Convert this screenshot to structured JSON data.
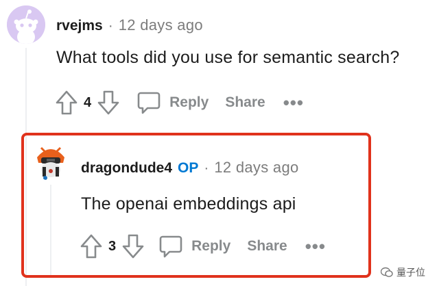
{
  "comment1": {
    "username": "rvejms",
    "separator": "·",
    "time": "12 days ago",
    "body": "What tools did you use for semantic search?",
    "votes": "4",
    "reply_label": "Reply",
    "share_label": "Share",
    "more_label": "•••"
  },
  "comment2": {
    "username": "dragondude4",
    "badge": "OP",
    "separator": "·",
    "time": "12 days ago",
    "body": "The openai embeddings api",
    "votes": "3",
    "reply_label": "Reply",
    "share_label": "Share",
    "more_label": "•••"
  },
  "watermark": {
    "text": "量子位"
  },
  "colors": {
    "highlight": "#e0321c",
    "op": "#0079d3",
    "muted": "#878a8c"
  }
}
